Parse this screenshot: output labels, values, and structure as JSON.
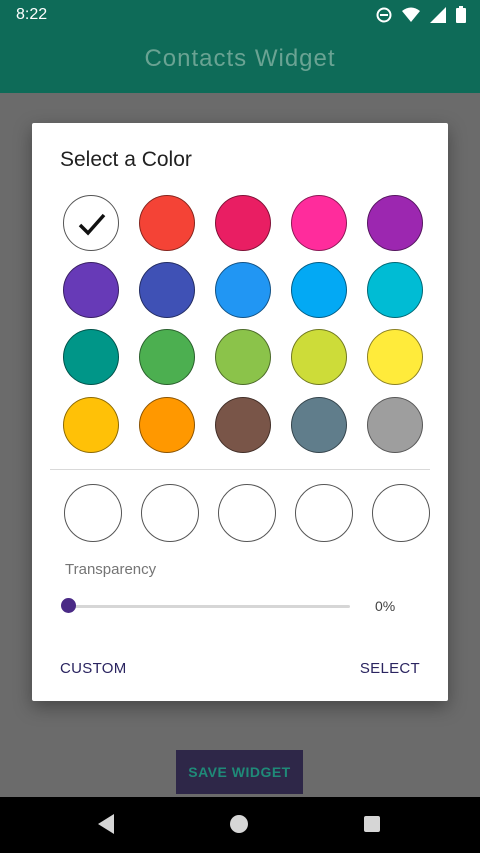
{
  "status_bar": {
    "time": "8:22",
    "icons": [
      "do-not-disturb-icon",
      "wifi-icon",
      "signal-icon",
      "battery-icon"
    ]
  },
  "app_bar": {
    "title": "Contacts Widget"
  },
  "background": {
    "save_button": "SAVE WIDGET"
  },
  "dialog": {
    "title": "Select a Color",
    "swatches": [
      {
        "color": "#ffffff",
        "selected": true
      },
      {
        "color": "#f44336"
      },
      {
        "color": "#e91e63"
      },
      {
        "color": "#ff2c9c"
      },
      {
        "color": "#9c27b0"
      },
      {
        "color": "#673ab7"
      },
      {
        "color": "#3f51b5"
      },
      {
        "color": "#2196f3"
      },
      {
        "color": "#03a9f4"
      },
      {
        "color": "#00bcd4"
      },
      {
        "color": "#009688"
      },
      {
        "color": "#4caf50"
      },
      {
        "color": "#8bc34a"
      },
      {
        "color": "#cddc39"
      },
      {
        "color": "#ffeb3b"
      },
      {
        "color": "#ffc107"
      },
      {
        "color": "#ff9800"
      },
      {
        "color": "#795548"
      },
      {
        "color": "#607d8b"
      },
      {
        "color": "#9e9e9e"
      }
    ],
    "recent_colors": [
      "#ffffff",
      "#ffffff",
      "#ffffff",
      "#ffffff",
      "#ffffff"
    ],
    "transparency_label": "Transparency",
    "transparency_value": "0%",
    "transparency_fraction": 0,
    "custom_button": "CUSTOM",
    "select_button": "SELECT"
  },
  "colors": {
    "primary": "#0e6b58",
    "accent": "#4a2a86",
    "button_text": "#2a2460"
  }
}
